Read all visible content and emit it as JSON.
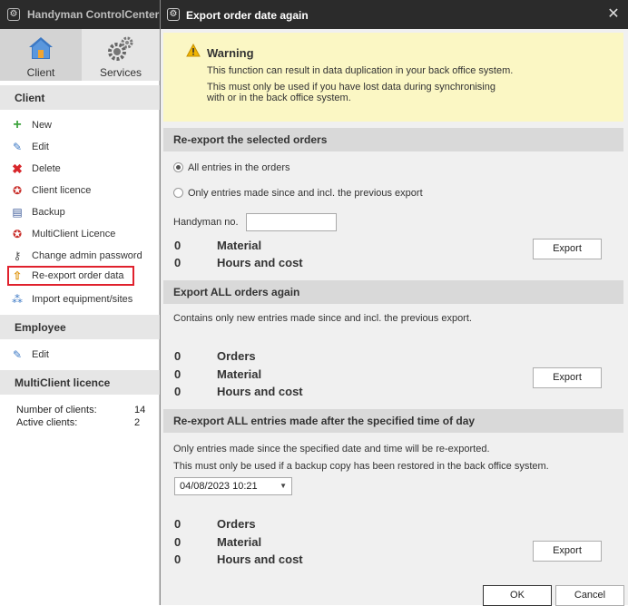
{
  "app": {
    "title": "Handyman ControlCenter",
    "nav_tabs": [
      {
        "label": "Client",
        "icon": "house-icon",
        "active": true
      },
      {
        "label": "Services",
        "icon": "gears-icon",
        "active": false
      }
    ],
    "sections": {
      "client": "Client",
      "employee": "Employee",
      "multiclient": "MultiClient licence"
    },
    "client_items": [
      {
        "label": "New",
        "icon": "plus-icon"
      },
      {
        "label": "Edit",
        "icon": "edit-icon"
      },
      {
        "label": "Delete",
        "icon": "delete-icon"
      },
      {
        "label": "Client licence",
        "icon": "licence-icon"
      },
      {
        "label": "Backup",
        "icon": "backup-icon"
      },
      {
        "label": "MultiClient Licence",
        "icon": "licence-icon"
      },
      {
        "label": "Change admin password",
        "icon": "key-icon"
      },
      {
        "label": "Re-export order data",
        "icon": "export-icon",
        "highlighted": true
      },
      {
        "label": "Import equipment/sites",
        "icon": "import-icon"
      }
    ],
    "employee_items": [
      {
        "label": "Edit",
        "icon": "edit-icon"
      }
    ],
    "licence_stats": {
      "clients_label": "Number of clients:",
      "clients_value": "14",
      "active_label": "Active clients:",
      "active_value": "2"
    }
  },
  "dialog": {
    "title": "Export order date again",
    "warning": {
      "title": "Warning",
      "line1": "This function can result in data duplication in your back office system.",
      "line2": "This must only be used if you have lost data during synchronising",
      "line3": "with or in the back office system."
    },
    "group1": {
      "header": "Re-export the selected orders",
      "radio_all": "All entries in the orders",
      "radio_since": "Only entries made since and incl. the previous export",
      "handyman_label": "Handyman no.",
      "handyman_value": "",
      "material_count": "0",
      "material_label": "Material",
      "hours_count": "0",
      "hours_label": "Hours and cost",
      "export_label": "Export"
    },
    "group2": {
      "header": "Export ALL orders again",
      "desc": "Contains only new entries made since and incl. the previous export.",
      "orders_count": "0",
      "orders_label": "Orders",
      "material_count": "0",
      "material_label": "Material",
      "hours_count": "0",
      "hours_label": "Hours and cost",
      "export_label": "Export"
    },
    "group3": {
      "header": "Re-export ALL entries made after the specified time of day",
      "desc1": "Only entries made since the specified date and time will be re-exported.",
      "desc2": "This must only be used if a backup copy has been restored in the back office system.",
      "datetime_value": "04/08/2023 10:21",
      "orders_count": "0",
      "orders_label": "Orders",
      "material_count": "0",
      "material_label": "Material",
      "hours_count": "0",
      "hours_label": "Hours and cost",
      "export_label": "Export"
    },
    "ok_label": "OK",
    "cancel_label": "Cancel"
  },
  "colors": {
    "titlebar": "#2b2b2b",
    "warning_bg": "#fbf7c4",
    "highlight_border": "#e0212d",
    "group_header": "#d9d9d9"
  }
}
